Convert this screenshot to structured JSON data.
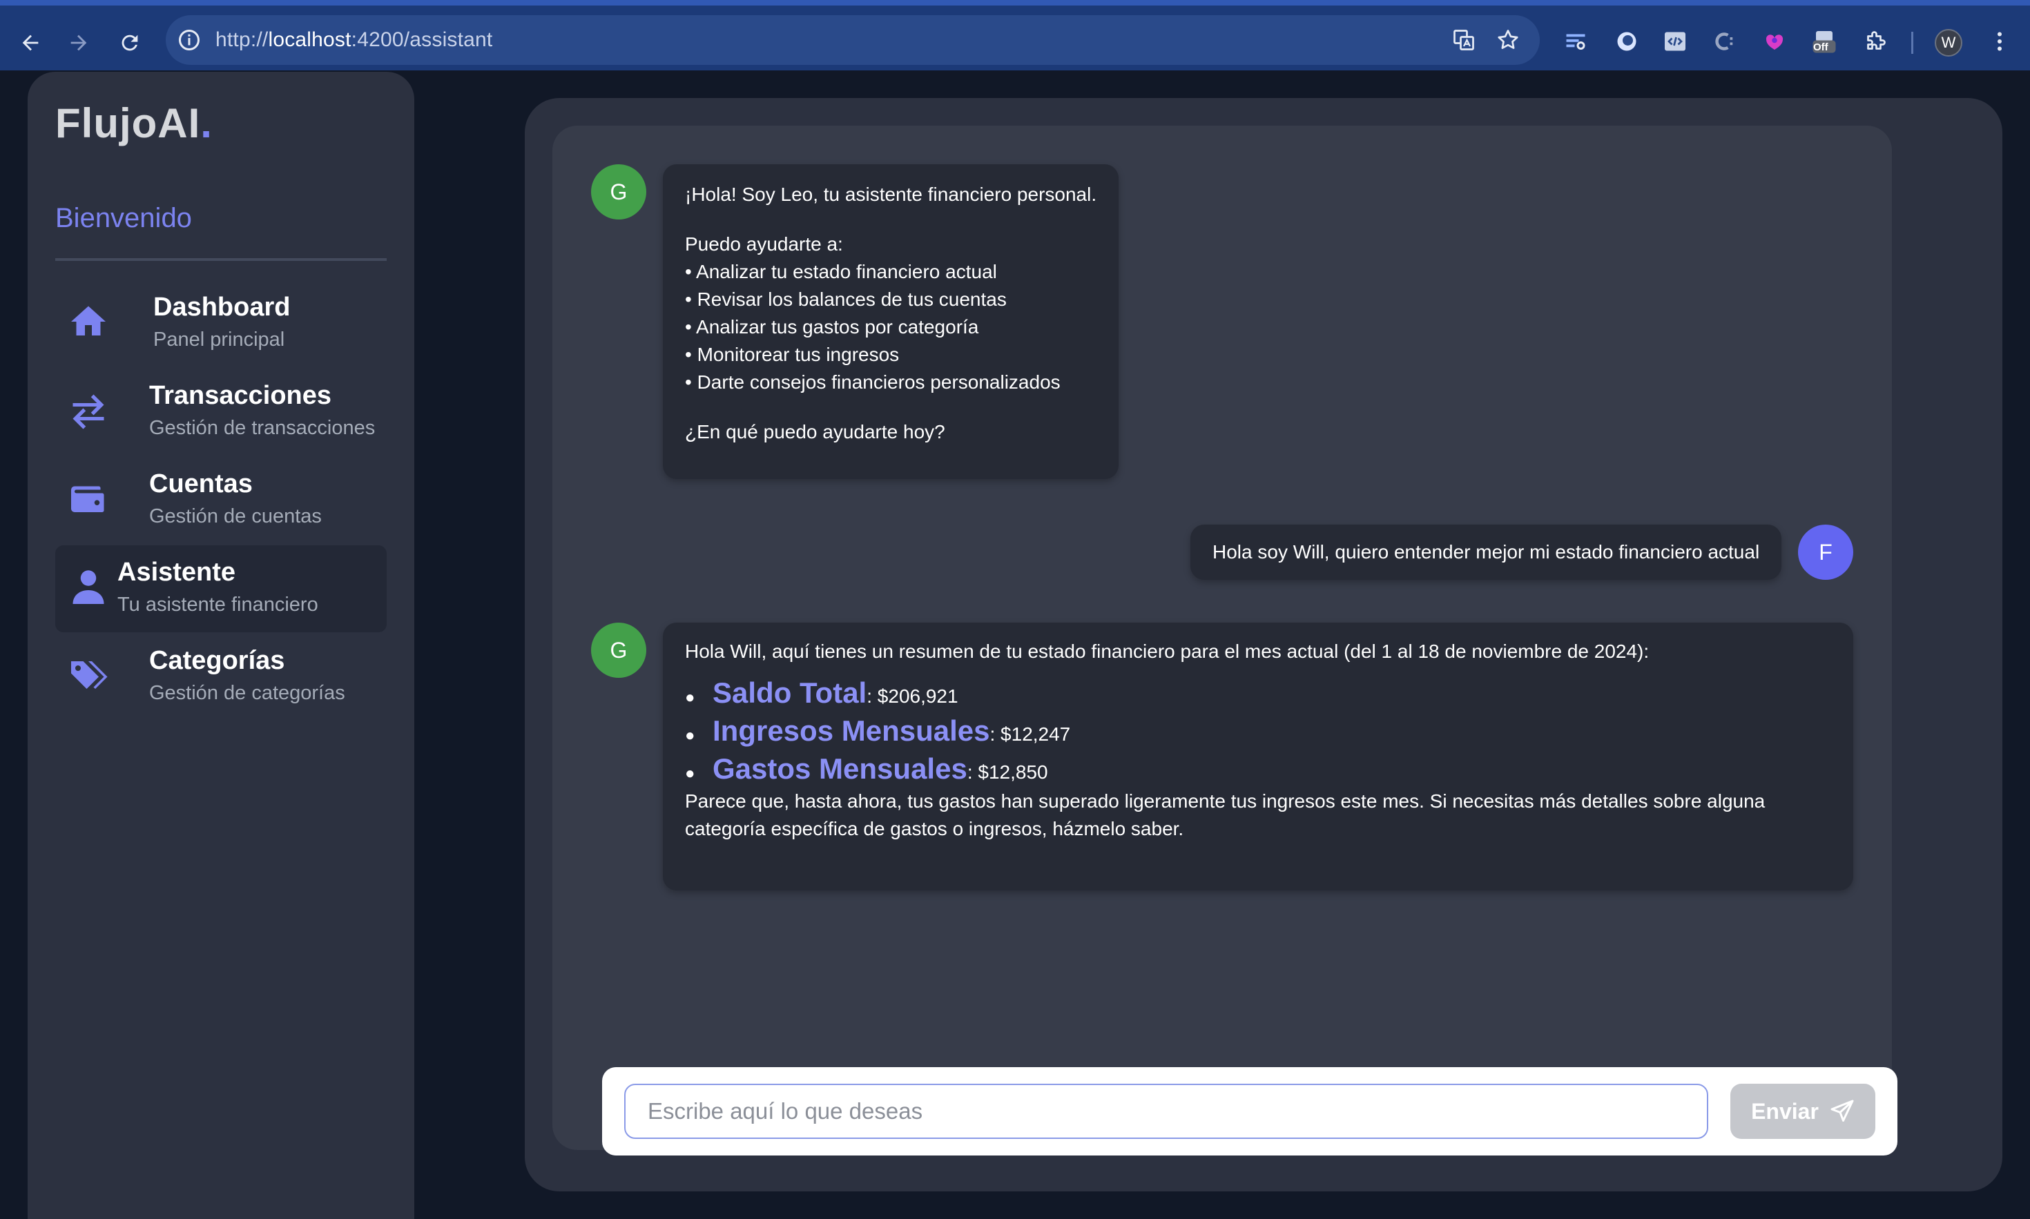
{
  "browser": {
    "url_scheme": "http://",
    "url_host": "localhost",
    "url_path": ":4200/assistant",
    "profile_initial": "W",
    "extension_badge": "Off"
  },
  "sidebar": {
    "logo_text": "FlujoAI",
    "logo_dot": ".",
    "welcome": "Bienvenido",
    "items": [
      {
        "title": "Dashboard",
        "subtitle": "Panel principal",
        "icon": "home-icon"
      },
      {
        "title": "Transacciones",
        "subtitle": "Gestión de transacciones",
        "icon": "swap-arrows-icon"
      },
      {
        "title": "Cuentas",
        "subtitle": "Gestión de cuentas",
        "icon": "wallet-icon"
      },
      {
        "title": "Asistente",
        "subtitle": "Tu asistente financiero",
        "icon": "user-icon",
        "active": true
      },
      {
        "title": "Categorías",
        "subtitle": "Gestión de categorías",
        "icon": "tags-icon"
      }
    ]
  },
  "chat": {
    "messages": [
      {
        "sender": "bot",
        "avatar": "G",
        "lines": [
          "¡Hola! Soy Leo, tu asistente financiero personal.",
          "",
          "Puedo ayudarte a:",
          "• Analizar tu estado financiero actual",
          "• Revisar los balances de tus cuentas",
          "• Analizar tus gastos por categoría",
          "• Monitorear tus ingresos",
          "• Darte consejos financieros personalizados",
          "",
          "¿En qué puedo ayudarte hoy?"
        ]
      },
      {
        "sender": "user",
        "avatar": "F",
        "text": "Hola soy Will, quiero entender mejor mi estado financiero actual"
      },
      {
        "sender": "bot",
        "avatar": "G",
        "intro": "Hola Will, aquí tienes un resumen de tu estado financiero para el mes actual (del 1 al 18 de noviembre de 2024):",
        "summary": [
          {
            "label": "Saldo Total",
            "value": ": $206,921"
          },
          {
            "label": "Ingresos Mensuales",
            "value": ": $12,247"
          },
          {
            "label": "Gastos Mensuales",
            "value": ": $12,850"
          }
        ],
        "outro_line1": "Parece que, hasta ahora, tus gastos han superado ligeramente tus ingresos este mes. Si necesitas más detalles sobre alguna",
        "outro_line2": "categoría específica de gastos o ingresos, házmelo saber."
      }
    ]
  },
  "composer": {
    "placeholder": "Escribe aquí lo que deseas",
    "value": "",
    "send_label": "Enviar"
  },
  "colors": {
    "accent": "#7c83f0",
    "bot_avatar": "#43a04a",
    "user_avatar": "#6366f1",
    "sidebar_bg": "#2c3140",
    "page_bg": "#111827"
  }
}
